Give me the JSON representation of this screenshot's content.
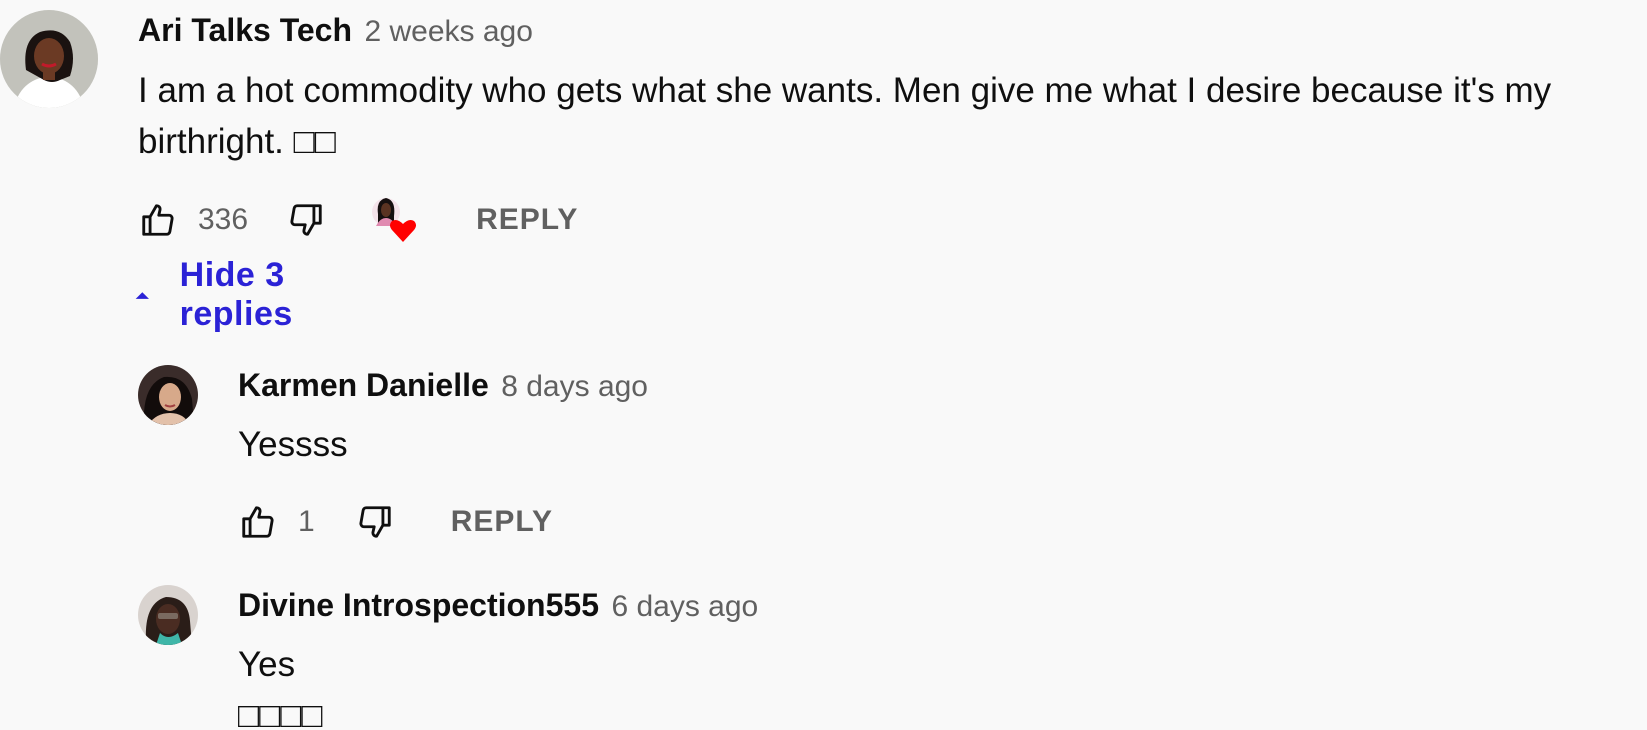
{
  "thread": {
    "comment": {
      "author": "Ari Talks Tech",
      "time": "2 weeks ago",
      "text": "I am a hot commodity who gets what she wants. Men give me what I desire because it's my birthright. □□",
      "likes": "336",
      "reply_label": "REPLY",
      "avatar_icon": "user-avatar",
      "hearted": true
    },
    "toggle_replies_label": "Hide 3 replies",
    "replies": [
      {
        "author": "Karmen Danielle",
        "time": "8 days ago",
        "text": "Yessss",
        "likes": "1",
        "reply_label": "REPLY"
      },
      {
        "author": "Divine Introspection555",
        "time": "6 days ago",
        "text": "Yes □□□□"
      }
    ]
  },
  "colors": {
    "background": "#f9f9f9",
    "text": "#0f0f0f",
    "secondary": "#606060",
    "link_blue": "#2b22d6",
    "heart_red": "#ff0000"
  }
}
